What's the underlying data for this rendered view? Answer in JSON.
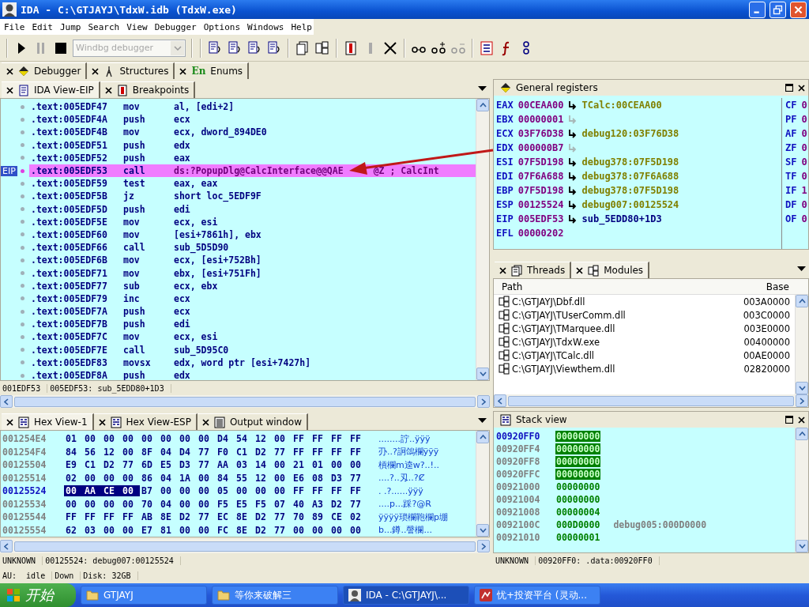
{
  "window": {
    "title": "IDA - C:\\GTJAYJ\\TdxW.idb (TdxW.exe)"
  },
  "menu": [
    "File",
    "Edit",
    "Jump",
    "Search",
    "View",
    "Debugger",
    "Options",
    "Windows",
    "Help"
  ],
  "toolbar": {
    "debugger_select": {
      "value": "Windbg debugger",
      "disabled": true
    }
  },
  "top_tabs": [
    {
      "label": "Debugger",
      "kind": "debugger"
    },
    {
      "label": "Structures",
      "kind": "structures"
    },
    {
      "label": "Enums",
      "kind": "enums",
      "icon_text": "En"
    }
  ],
  "ida_view": {
    "tabs": [
      {
        "label": "IDA View-EIP",
        "kind": "listing",
        "selected": true
      },
      {
        "label": "Breakpoints",
        "kind": "breakpoints",
        "selected": false
      }
    ],
    "eip_label": "EIP",
    "rows": [
      {
        "address": ".text:005EDF47",
        "mnemonic": "mov",
        "operand": "al, [edi+2]",
        "current": false
      },
      {
        "address": ".text:005EDF4A",
        "mnemonic": "push",
        "operand": "ecx",
        "current": false
      },
      {
        "address": ".text:005EDF4B",
        "mnemonic": "mov",
        "operand": "ecx, dword_894DE0",
        "current": false
      },
      {
        "address": ".text:005EDF51",
        "mnemonic": "push",
        "operand": "edx",
        "current": false
      },
      {
        "address": ".text:005EDF52",
        "mnemonic": "push",
        "operand": "eax",
        "current": false
      },
      {
        "address": ".text:005EDF53",
        "mnemonic": "call",
        "operand": "ds:?PopupDlg@CalcInterface@@QAE",
        "comment": "@Z ; CalcInt",
        "current": true
      },
      {
        "address": ".text:005EDF59",
        "mnemonic": "test",
        "operand": "eax, eax",
        "current": false
      },
      {
        "address": ".text:005EDF5B",
        "mnemonic": "jz",
        "operand": "short loc_5EDF9F",
        "current": false
      },
      {
        "address": ".text:005EDF5D",
        "mnemonic": "push",
        "operand": "edi",
        "current": false
      },
      {
        "address": ".text:005EDF5E",
        "mnemonic": "mov",
        "operand": "ecx, esi",
        "current": false
      },
      {
        "address": ".text:005EDF60",
        "mnemonic": "mov",
        "operand": "[esi+7861h], ebx",
        "current": false
      },
      {
        "address": ".text:005EDF66",
        "mnemonic": "call",
        "operand": "sub_5D5D90",
        "current": false
      },
      {
        "address": ".text:005EDF6B",
        "mnemonic": "mov",
        "operand": "ecx, [esi+752Bh]",
        "current": false
      },
      {
        "address": ".text:005EDF71",
        "mnemonic": "mov",
        "operand": "ebx, [esi+751Fh]",
        "current": false
      },
      {
        "address": ".text:005EDF77",
        "mnemonic": "sub",
        "operand": "ecx, ebx",
        "current": false
      },
      {
        "address": ".text:005EDF79",
        "mnemonic": "inc",
        "operand": "ecx",
        "current": false
      },
      {
        "address": ".text:005EDF7A",
        "mnemonic": "push",
        "operand": "ecx",
        "current": false
      },
      {
        "address": ".text:005EDF7B",
        "mnemonic": "push",
        "operand": "edi",
        "current": false
      },
      {
        "address": ".text:005EDF7C",
        "mnemonic": "mov",
        "operand": "ecx, esi",
        "current": false
      },
      {
        "address": ".text:005EDF7E",
        "mnemonic": "call",
        "operand": "sub_5D95C0",
        "current": false
      },
      {
        "address": ".text:005EDF83",
        "mnemonic": "movsx",
        "operand": "edx, word ptr [esi+7427h]",
        "current": false
      },
      {
        "address": ".text:005EDF8A",
        "mnemonic": "push",
        "operand": "edx",
        "current": false
      }
    ],
    "status": [
      "001EDF53",
      "005EDF53: sub_5EDD80+1D3"
    ]
  },
  "registers": {
    "title": "General registers",
    "rows": [
      {
        "name": "EAX",
        "value": "00CEAA00",
        "points": true,
        "target": "TCalc:00CEAA00"
      },
      {
        "name": "EBX",
        "value": "00000001",
        "points": false
      },
      {
        "name": "ECX",
        "value": "03F76D38",
        "points": true,
        "target": "debug120:03F76D38"
      },
      {
        "name": "EDX",
        "value": "000000B7",
        "points": false
      },
      {
        "name": "ESI",
        "value": "07F5D198",
        "points": true,
        "target": "debug378:07F5D198"
      },
      {
        "name": "EDI",
        "value": "07F6A688",
        "points": true,
        "target": "debug378:07F6A688"
      },
      {
        "name": "EBP",
        "value": "07F5D198",
        "points": true,
        "target": "debug378:07F5D198"
      },
      {
        "name": "ESP",
        "value": "00125524",
        "points": true,
        "target": "debug007:00125524"
      },
      {
        "name": "EIP",
        "value": "005EDF53",
        "points": true,
        "target": "sub_5EDD80+1D3",
        "kind": "code"
      },
      {
        "name": "EFL",
        "value": "00000202"
      }
    ],
    "flags": [
      {
        "name": "CF",
        "value": "0"
      },
      {
        "name": "PF",
        "value": "0"
      },
      {
        "name": "AF",
        "value": "0"
      },
      {
        "name": "ZF",
        "value": "0"
      },
      {
        "name": "SF",
        "value": "0"
      },
      {
        "name": "TF",
        "value": "0"
      },
      {
        "name": "IF",
        "value": "1"
      },
      {
        "name": "DF",
        "value": "0"
      },
      {
        "name": "OF",
        "value": "0"
      }
    ]
  },
  "modules_panel": {
    "tabs": [
      {
        "label": "Threads",
        "kind": "threads",
        "selected": false
      },
      {
        "label": "Modules",
        "kind": "modules",
        "selected": true
      }
    ],
    "columns": [
      "Path",
      "Base"
    ],
    "rows": [
      {
        "path": "C:\\GTJAYJ\\Dbf.dll",
        "base": "003A0000"
      },
      {
        "path": "C:\\GTJAYJ\\TUserComm.dll",
        "base": "003C0000"
      },
      {
        "path": "C:\\GTJAYJ\\TMarquee.dll",
        "base": "003E0000"
      },
      {
        "path": "C:\\GTJAYJ\\TdxW.exe",
        "base": "00400000"
      },
      {
        "path": "C:\\GTJAYJ\\TCalc.dll",
        "base": "00AE0000"
      },
      {
        "path": "C:\\GTJAYJ\\Viewthem.dll",
        "base": "02820000"
      }
    ]
  },
  "hex_view": {
    "tabs": [
      {
        "label": "Hex View-1",
        "kind": "hex",
        "selected": true
      },
      {
        "label": "Hex View-ESP",
        "kind": "hex",
        "selected": false
      },
      {
        "label": "Output window",
        "kind": "output",
        "selected": false
      }
    ],
    "rows": [
      {
        "address": "001254E4",
        "bytes": [
          "01",
          "00",
          "00",
          "00",
          "00",
          "00",
          "00",
          "00",
          "D4",
          "54",
          "12",
          "00",
          "FF",
          "FF",
          "FF",
          "FF"
        ],
        "ascii": "........詝..ÿÿÿ",
        "current": false
      },
      {
        "address": "001254F4",
        "bytes": [
          "84",
          "56",
          "12",
          "00",
          "8F",
          "04",
          "D4",
          "77",
          "F0",
          "C1",
          "D2",
          "77",
          "FF",
          "FF",
          "FF",
          "FF"
        ],
        "ascii": "刅..?詗鴿欄ÿÿÿ",
        "current": false
      },
      {
        "address": "00125504",
        "bytes": [
          "E9",
          "C1",
          "D2",
          "77",
          "6D",
          "E5",
          "D3",
          "77",
          "AA",
          "03",
          "14",
          "00",
          "21",
          "01",
          "00",
          "00"
        ],
        "ascii": "槓欄m逵w?..!..",
        "current": false
      },
      {
        "address": "00125514",
        "bytes": [
          "02",
          "00",
          "00",
          "00",
          "86",
          "04",
          "1A",
          "00",
          "84",
          "55",
          "12",
          "00",
          "E6",
          "08",
          "D3",
          "77"
        ],
        "ascii": "....?..刄..?Ȼ",
        "current": false
      },
      {
        "address": "00125524",
        "selected_bytes": [
          "00",
          "AA",
          "CE",
          "00"
        ],
        "bytes": [
          "B7",
          "00",
          "00",
          "00",
          "05",
          "00",
          "00",
          "00",
          "FF",
          "FF",
          "FF",
          "FF"
        ],
        "ascii": ".  .?......ÿÿÿ",
        "current": true
      },
      {
        "address": "00125534",
        "bytes": [
          "00",
          "00",
          "00",
          "00",
          "70",
          "04",
          "00",
          "00",
          "F5",
          "E5",
          "F5",
          "07",
          "40",
          "A3",
          "D2",
          "77"
        ],
        "ascii": "....p...踩?@R",
        "current": false
      },
      {
        "address": "00125544",
        "bytes": [
          "FF",
          "FF",
          "FF",
          "FF",
          "AB",
          "8E",
          "D2",
          "77",
          "EC",
          "8E",
          "D2",
          "77",
          "70",
          "89",
          "CE",
          "02"
        ],
        "ascii": "ÿÿÿÿ琐欄鞄欄p堋",
        "current": false
      },
      {
        "address": "00125554",
        "bytes": [
          "62",
          "03",
          "00",
          "00",
          "E7",
          "81",
          "00",
          "00",
          "FC",
          "8E",
          "D2",
          "77",
          "00",
          "00",
          "00",
          "00"
        ],
        "ascii": "b...鐏..謦欄...",
        "current": false
      }
    ],
    "status": [
      "UNKNOWN",
      "00125524: debug007:00125524"
    ]
  },
  "stack_view": {
    "title": "Stack view",
    "rows": [
      {
        "address": "00920FF0",
        "value": "00000000",
        "current": true,
        "highlighted": true
      },
      {
        "address": "00920FF4",
        "value": "00000000",
        "current": false,
        "highlighted": true
      },
      {
        "address": "00920FF8",
        "value": "00000000",
        "current": false,
        "highlighted": true
      },
      {
        "address": "00920FFC",
        "value": "00000000",
        "current": false,
        "highlighted": true
      },
      {
        "address": "00921000",
        "value": "00000000",
        "current": false,
        "highlighted": false
      },
      {
        "address": "00921004",
        "value": "00000000",
        "current": false,
        "highlighted": false
      },
      {
        "address": "00921008",
        "value": "00000004",
        "current": false,
        "highlighted": false
      },
      {
        "address": "0092100C",
        "value": "000D0000",
        "comment": "debug005:000D0000",
        "current": false,
        "highlighted": false
      },
      {
        "address": "00921010",
        "value": "00000001",
        "current": false,
        "highlighted": false
      }
    ],
    "status": [
      "UNKNOWN",
      "00920FF0: .data:00920FF0"
    ]
  },
  "status_bar": [
    "AU:  idle",
    "Down",
    "Disk: 32GB"
  ],
  "taskbar": {
    "start": "开始",
    "items": [
      {
        "label": "GTJAYJ",
        "kind": "folder",
        "selected": false
      },
      {
        "label": "等你来破解三",
        "kind": "folder",
        "selected": false
      },
      {
        "label": "IDA - C:\\GTJAYJ\\...",
        "kind": "ida",
        "selected": true
      },
      {
        "label": "忧+投资平台 (灵动...",
        "kind": "app",
        "selected": false
      }
    ]
  }
}
